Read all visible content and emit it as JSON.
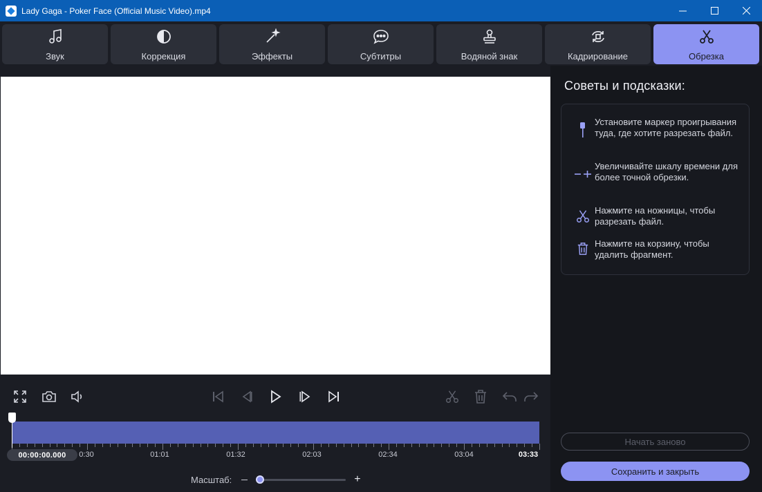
{
  "window": {
    "title": "Lady Gaga - Poker Face (Official Music Video).mp4",
    "controls": [
      "minimize",
      "maximize",
      "close"
    ]
  },
  "tabs": [
    {
      "label": "Звук",
      "icon": "music-note-icon",
      "active": false
    },
    {
      "label": "Коррекция",
      "icon": "contrast-icon",
      "active": false
    },
    {
      "label": "Эффекты",
      "icon": "magic-wand-icon",
      "active": false
    },
    {
      "label": "Субтитры",
      "icon": "speech-bubble-icon",
      "active": false
    },
    {
      "label": "Водяной знак",
      "icon": "stamp-icon",
      "active": false
    },
    {
      "label": "Кадрирование",
      "icon": "rotate-crop-icon",
      "active": false
    },
    {
      "label": "Обрезка",
      "icon": "scissors-icon",
      "active": true
    }
  ],
  "player": {
    "left_controls": [
      "fullscreen-icon",
      "camera-icon",
      "volume-icon"
    ],
    "center_controls": [
      "skip-start-icon",
      "prev-frame-icon",
      "play-icon",
      "next-frame-icon",
      "skip-end-icon"
    ],
    "right_controls": [
      "scissors-icon",
      "trash-icon",
      "undo-icon",
      "redo-icon"
    ]
  },
  "timeline": {
    "current_time": "00:00:00.000",
    "tick_labels": [
      "0:30",
      "01:01",
      "01:32",
      "02:03",
      "02:34",
      "03:04",
      "03:33"
    ]
  },
  "zoom": {
    "label": "Масштаб:",
    "level": 0
  },
  "tips": {
    "title": "Советы и подсказки:",
    "items": [
      {
        "icon": "marker-icon",
        "text": "Установите маркер проигрывания туда, где хотите разрезать файл."
      },
      {
        "icon": "zoom-timeline-icon",
        "text": "Увеличивайте шкалу времени для более точной обрезки."
      },
      {
        "icon": "scissors-icon",
        "text": "Нажмите на ножницы, чтобы разрезать файл."
      },
      {
        "icon": "trash-icon",
        "text": "Нажмите на корзину, чтобы удалить фрагмент."
      }
    ]
  },
  "buttons": {
    "restart": "Начать заново",
    "save": "Сохранить и закрыть"
  },
  "colors": {
    "accent": "#8c93f2",
    "titlebar": "#0b5fb6",
    "track": "#5560b4",
    "background": "#1b1d24"
  }
}
